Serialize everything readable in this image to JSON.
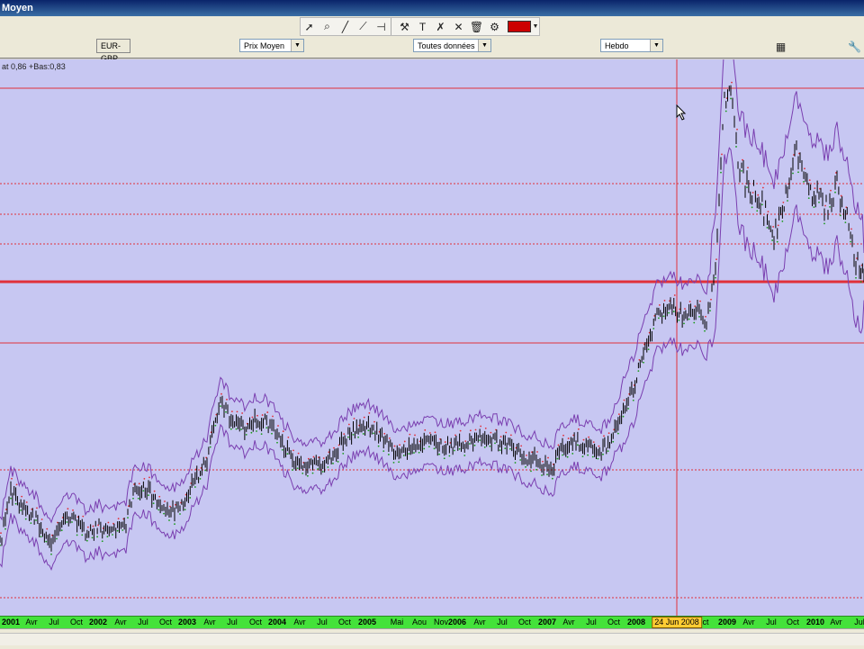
{
  "window": {
    "title": "Moyen"
  },
  "toolbar": {
    "buttons": [
      "pointer-icon",
      "zoom-icon",
      "draw-line-icon",
      "trend-line-icon",
      "horizontal-line-icon",
      "indicator-icon",
      "text-icon",
      "fibonacci-icon",
      "cross-icon",
      "trash-icon",
      "tools-icon"
    ],
    "line_color": "#cc0000"
  },
  "selectors": {
    "symbol": "EUR-GBP",
    "price_type": "Prix Moyen",
    "data_range": "Toutes données",
    "period": "Hebdo"
  },
  "chart": {
    "legend": "at 0,86 +Bas:0,83",
    "background": "#c7c7f2",
    "price_color": "#000000",
    "band_color": "#7a3fb0",
    "level_color": "#e0303a",
    "cursor_date": "24 Jun 2008"
  },
  "xaxis": {
    "labels": [
      {
        "t": "2001",
        "year": true
      },
      {
        "t": "Avr"
      },
      {
        "t": "Jul"
      },
      {
        "t": "Oct"
      },
      {
        "t": "2002",
        "year": true
      },
      {
        "t": "Avr"
      },
      {
        "t": "Jul"
      },
      {
        "t": "Oct"
      },
      {
        "t": "2003",
        "year": true
      },
      {
        "t": "Avr"
      },
      {
        "t": "Jul"
      },
      {
        "t": "Oct"
      },
      {
        "t": "2004",
        "year": true
      },
      {
        "t": "Avr"
      },
      {
        "t": "Jul"
      },
      {
        "t": "Oct"
      },
      {
        "t": "2005",
        "year": true
      },
      {
        "t": "Mai"
      },
      {
        "t": "Aou"
      },
      {
        "t": "Nov"
      },
      {
        "t": "2006",
        "year": true
      },
      {
        "t": "Avr"
      },
      {
        "t": "Jul"
      },
      {
        "t": "Oct"
      },
      {
        "t": "2007",
        "year": true
      },
      {
        "t": "Avr"
      },
      {
        "t": "Jul"
      },
      {
        "t": "Oct"
      },
      {
        "t": "2008",
        "year": true
      },
      {
        "t": "ct"
      },
      {
        "t": "2009",
        "year": true
      },
      {
        "t": "Avr"
      },
      {
        "t": "Jul"
      },
      {
        "t": "Oct"
      },
      {
        "t": "2010",
        "year": true
      },
      {
        "t": "Avr"
      },
      {
        "t": "Jul"
      }
    ]
  }
}
